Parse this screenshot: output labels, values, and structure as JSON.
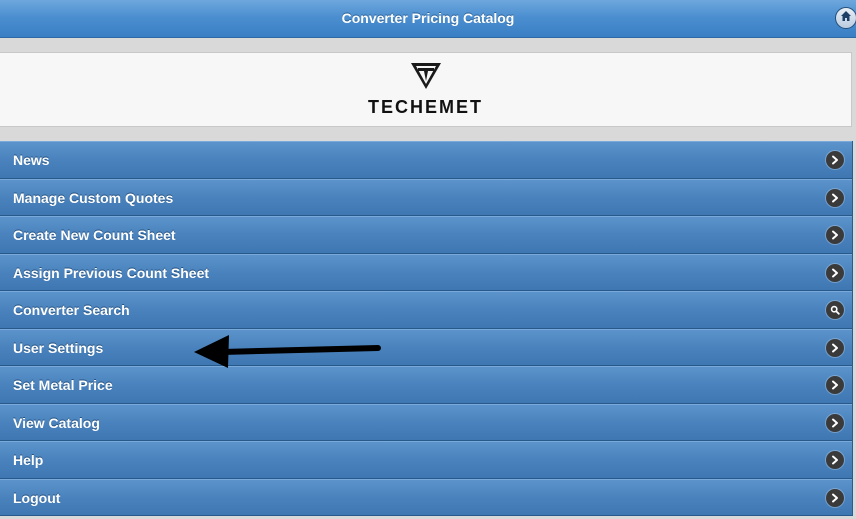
{
  "header": {
    "title": "Converter Pricing Catalog",
    "home_icon": "home-icon"
  },
  "logo": {
    "text": "TECHEMET"
  },
  "menu": {
    "items": [
      {
        "label": "News",
        "icon": "chevron-right-icon"
      },
      {
        "label": "Manage Custom Quotes",
        "icon": "chevron-right-icon"
      },
      {
        "label": "Create New Count Sheet",
        "icon": "chevron-right-icon"
      },
      {
        "label": "Assign Previous Count Sheet",
        "icon": "chevron-right-icon"
      },
      {
        "label": "Converter Search",
        "icon": "search-icon"
      },
      {
        "label": "User Settings",
        "icon": "chevron-right-icon"
      },
      {
        "label": "Set Metal Price",
        "icon": "chevron-right-icon"
      },
      {
        "label": "View Catalog",
        "icon": "chevron-right-icon"
      },
      {
        "label": "Help",
        "icon": "chevron-right-icon"
      },
      {
        "label": "Logout",
        "icon": "chevron-right-icon"
      }
    ]
  },
  "colors": {
    "header": "#4b8fd0",
    "menu_item": "#4a82bd",
    "icon_bg": "#3a3a3a",
    "annotation_arrow": "#000000"
  }
}
